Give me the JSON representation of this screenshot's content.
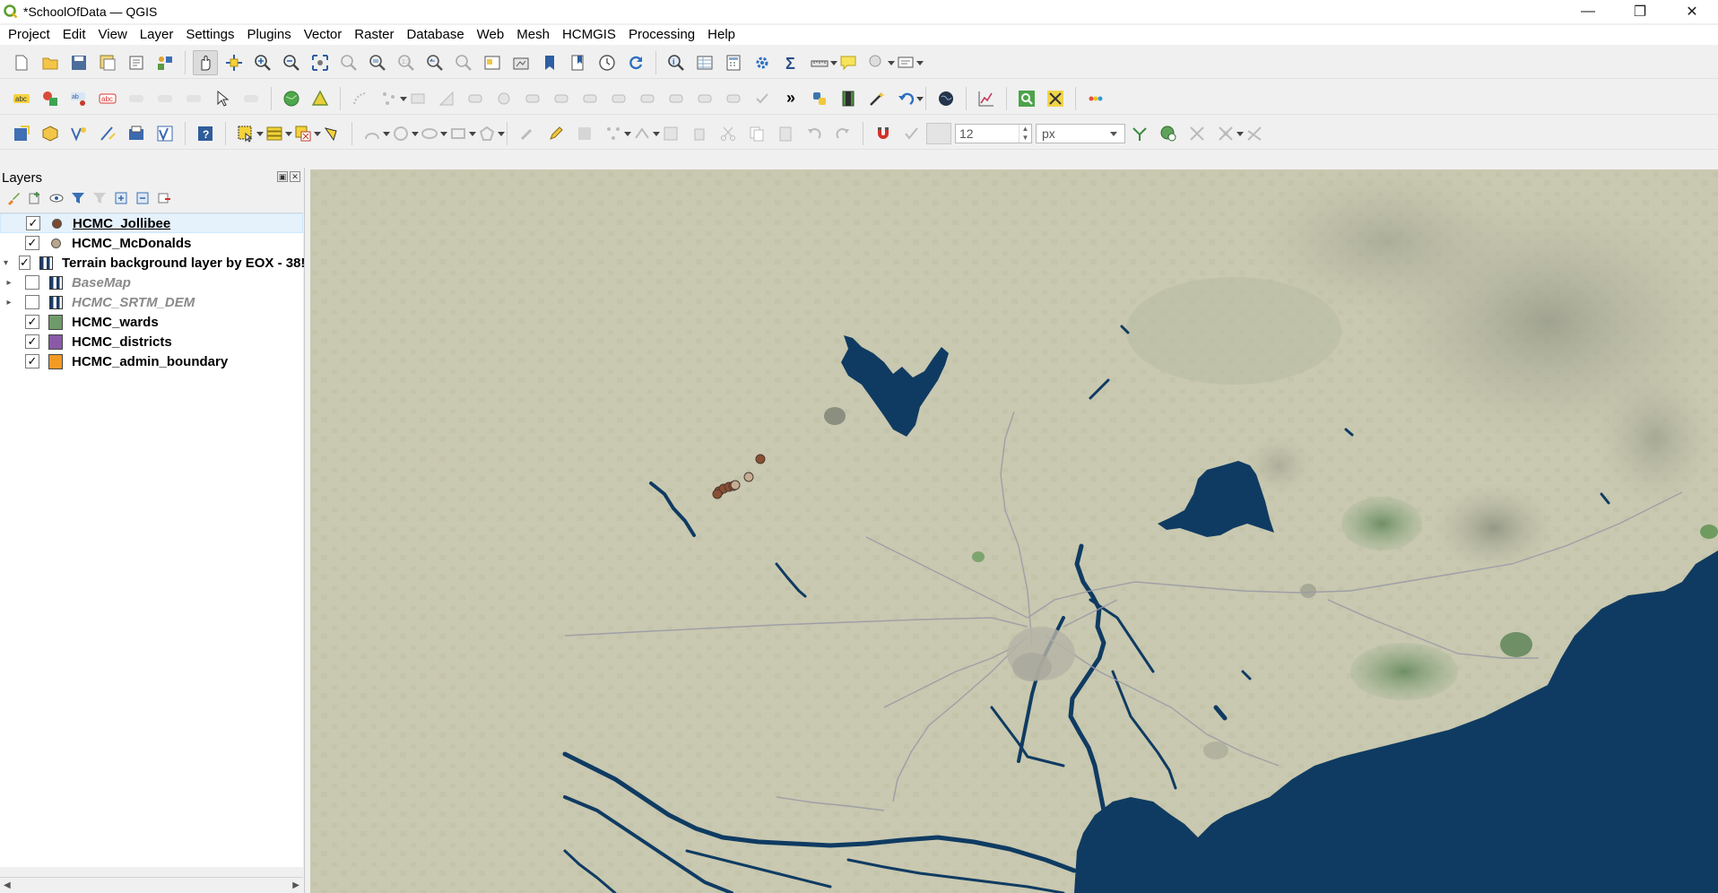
{
  "window": {
    "title": "*SchoolOfData — QGIS",
    "minimize_glyph": "—",
    "restore_glyph": "❐",
    "close_glyph": "✕"
  },
  "menubar": {
    "items": [
      {
        "label": "Project",
        "accel": "P",
        "rest": "roject"
      },
      {
        "label": "Edit",
        "accel": "E",
        "rest": "dit"
      },
      {
        "label": "View",
        "accel": "V",
        "rest": "iew"
      },
      {
        "label": "Layer",
        "accel": "L",
        "rest": "ayer"
      },
      {
        "label": "Settings",
        "accel": "S",
        "rest": "ettings"
      },
      {
        "label": "Plugins",
        "accel": "P",
        "rest": "lugins"
      },
      {
        "label": "Vector",
        "accel": "o",
        "pre": "Vect",
        "rest": "r"
      },
      {
        "label": "Raster",
        "accel": "R",
        "rest": "aster"
      },
      {
        "label": "Database",
        "accel": "D",
        "rest": "atabase"
      },
      {
        "label": "Web",
        "accel": "W",
        "rest": "eb"
      },
      {
        "label": "Mesh",
        "accel": "M",
        "rest": "esh"
      },
      {
        "label": "HCMGIS",
        "accel": "",
        "rest": "HCMGIS"
      },
      {
        "label": "Processing",
        "accel": "",
        "rest": "Processing"
      },
      {
        "label": "Help",
        "accel": "H",
        "rest": "elp"
      }
    ]
  },
  "digitizing": {
    "snap_tolerance_value": "12",
    "snap_units": "px"
  },
  "layers_panel": {
    "title": "Layers",
    "float_glyph": "▣",
    "close_glyph": "✕",
    "layers": [
      {
        "name": "HCMC_Jollibee",
        "checked": true,
        "symbol": "point",
        "color": "#7b4a2e",
        "expandable": false,
        "visible": true
      },
      {
        "name": "HCMC_McDonalds",
        "checked": true,
        "symbol": "point",
        "color": "#b9a58c",
        "expandable": false,
        "visible": true
      },
      {
        "name": "Terrain background layer by EOX - 38!",
        "checked": true,
        "symbol": "raster",
        "color": "#1b3c6a",
        "expandable": true,
        "expanded": true,
        "visible": true
      },
      {
        "name": "BaseMap",
        "checked": false,
        "symbol": "raster",
        "color": "#1b3c6a",
        "expandable": true,
        "expanded": false,
        "visible": false
      },
      {
        "name": "HCMC_SRTM_DEM",
        "checked": false,
        "symbol": "raster",
        "color": "#1b3c6a",
        "expandable": true,
        "expanded": false,
        "visible": false
      },
      {
        "name": "HCMC_wards",
        "checked": true,
        "symbol": "polygon",
        "color": "#6f9b6a",
        "expandable": false,
        "visible": true
      },
      {
        "name": "HCMC_districts",
        "checked": true,
        "symbol": "polygon",
        "color": "#8a5aa6",
        "expandable": false,
        "visible": true
      },
      {
        "name": "HCMC_admin_boundary",
        "checked": true,
        "symbol": "polygon",
        "color": "#f39a24",
        "expandable": false,
        "visible": true
      }
    ]
  },
  "map": {
    "land_color": "#c9c8b0",
    "water_color": "#0f3b62",
    "forest_color": "#7f9e78",
    "jollibee_color": "#8a4f33",
    "mcdonalds_color": "#c4ad93"
  },
  "glyphs": {
    "check": "✓",
    "expand_open": "▾",
    "expand_closed": "▸",
    "more": "»",
    "spin_up": "▲",
    "spin_down": "▼",
    "scroll_left": "◀",
    "scroll_right": "▶"
  }
}
